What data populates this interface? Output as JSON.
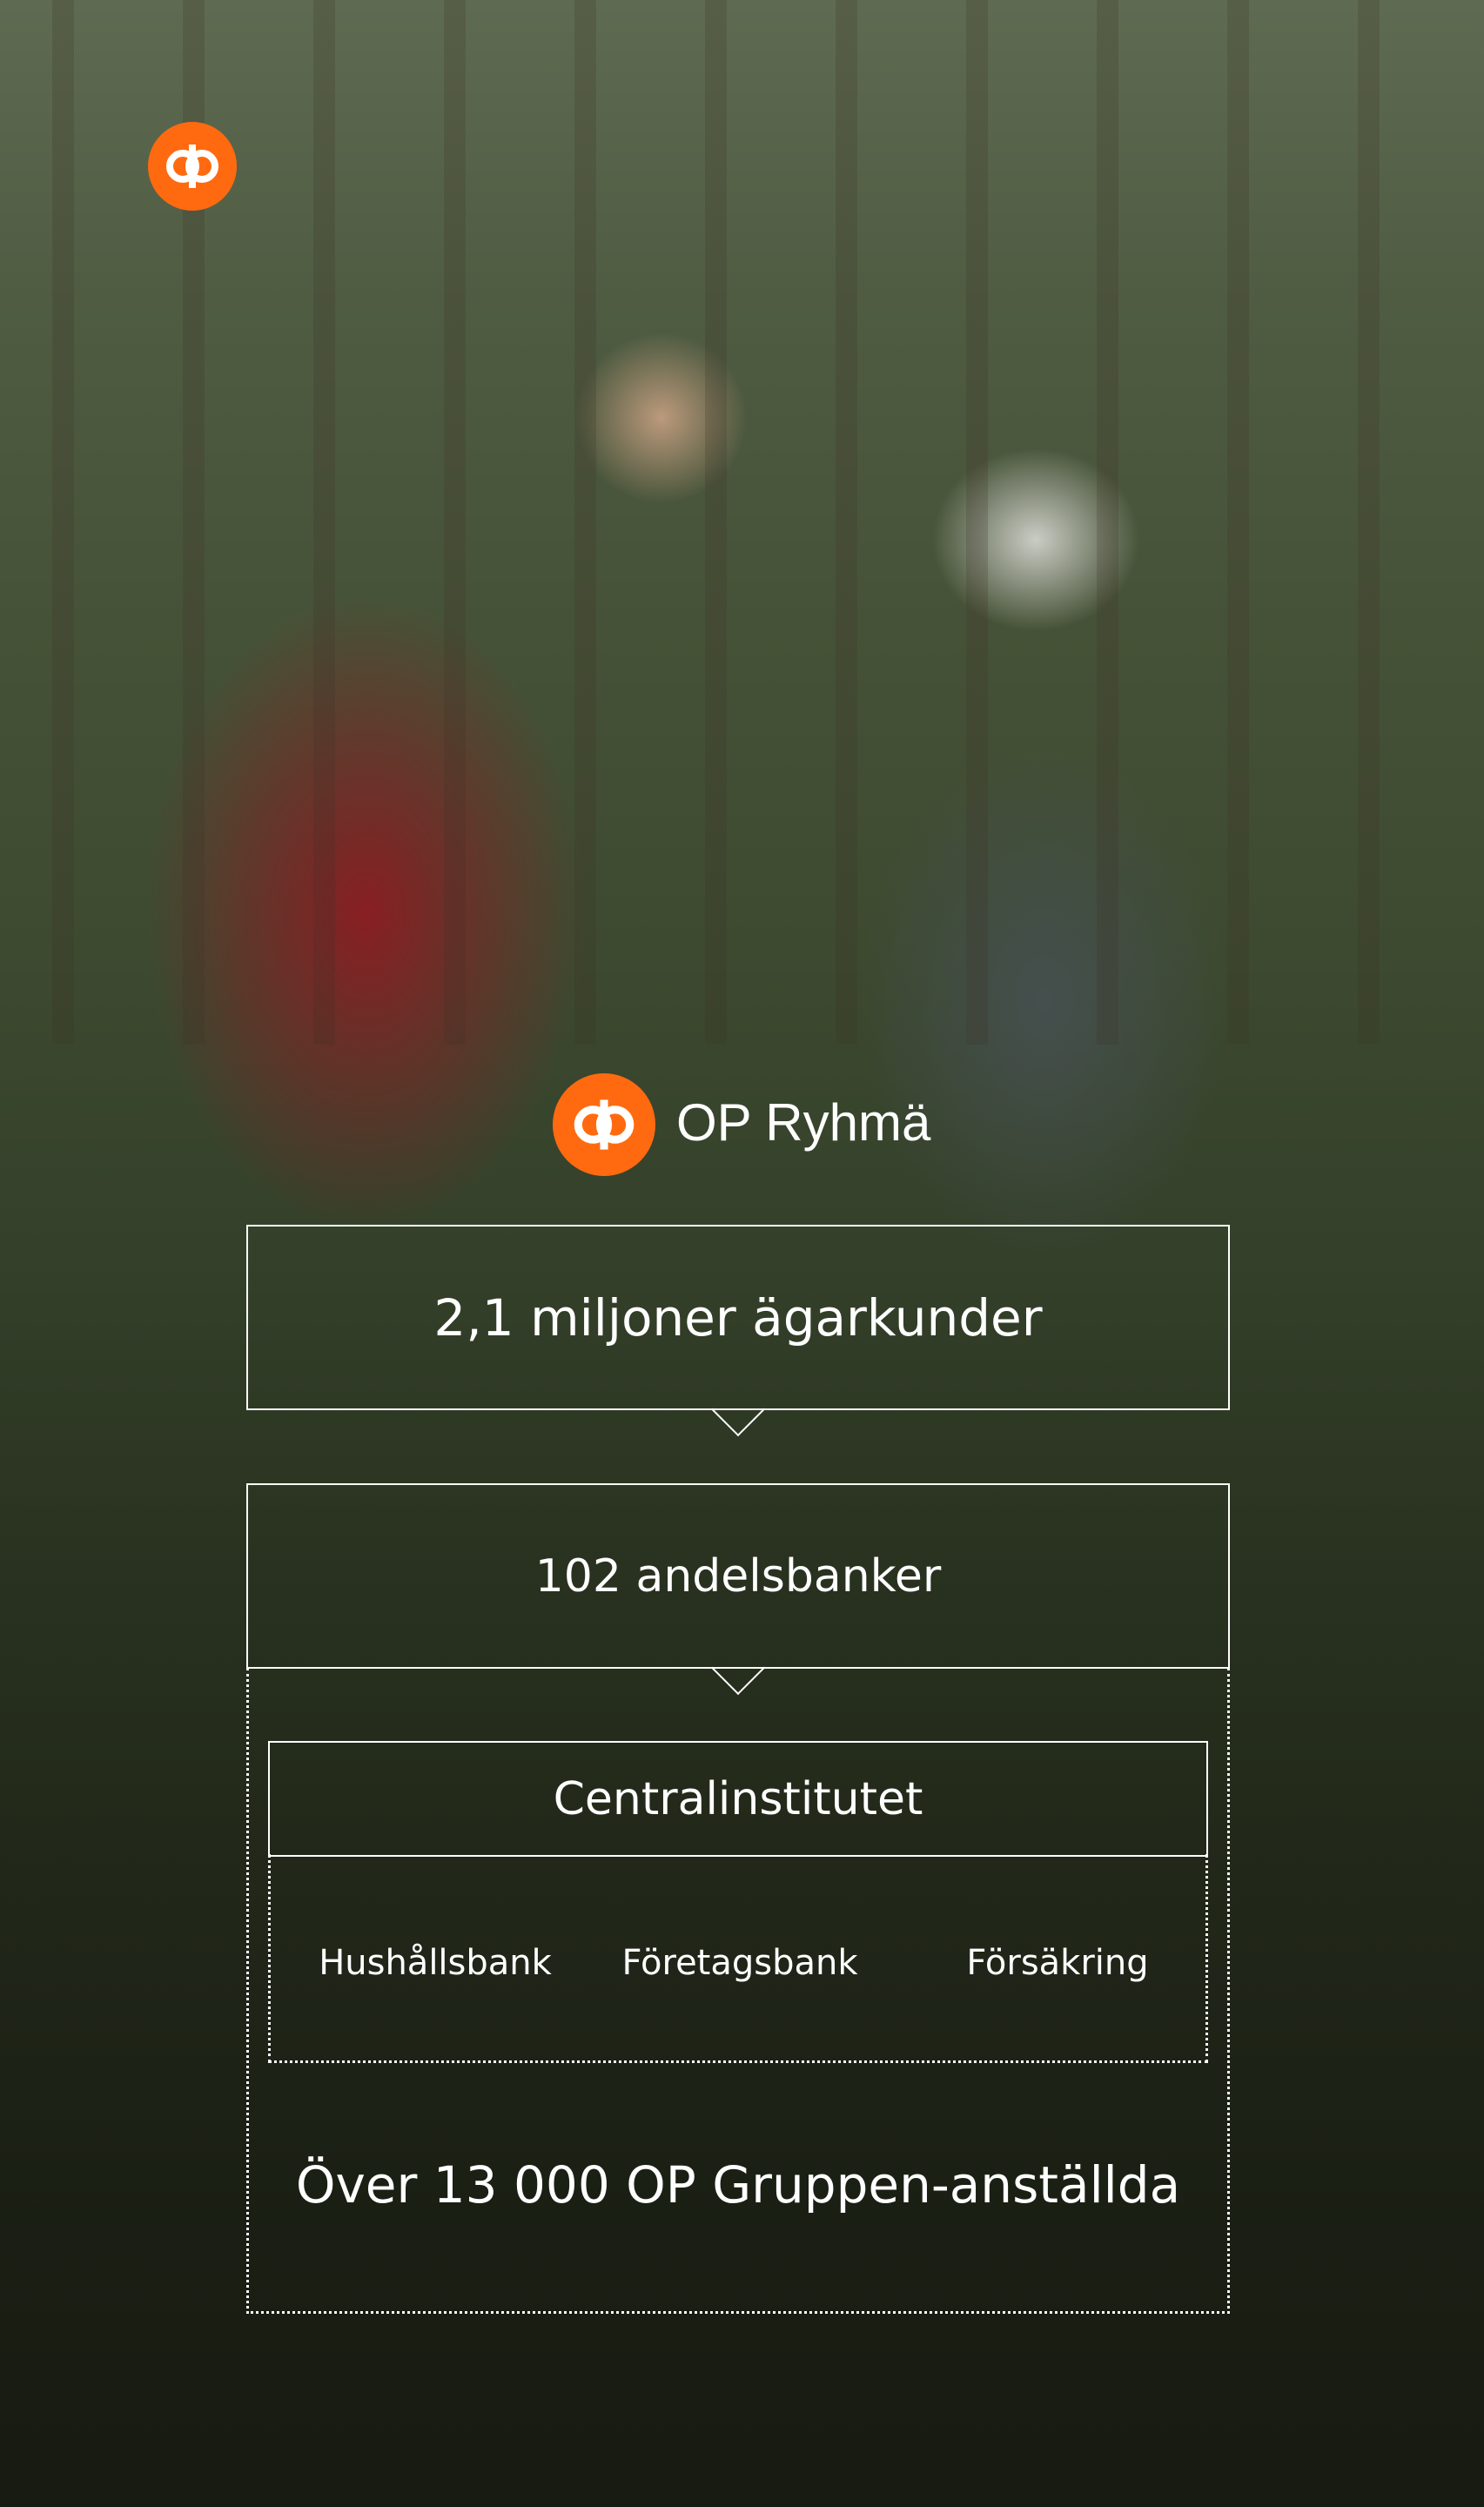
{
  "brand": {
    "name": "OP Ryhmä",
    "logo_icon": "op-logo-icon",
    "logo_color": "#ff6a10"
  },
  "structure": {
    "owners": "2,1 miljoner ägarkunder",
    "banks": "102 andelsbanker",
    "central": "Centralinstitutet",
    "units": [
      "Hushållsbank",
      "Företagsbank",
      "Försäkring"
    ],
    "employees": "Över 13 000 OP Gruppen-anställda"
  },
  "colors": {
    "box_border": "#ffffff",
    "text": "#ffffff"
  }
}
